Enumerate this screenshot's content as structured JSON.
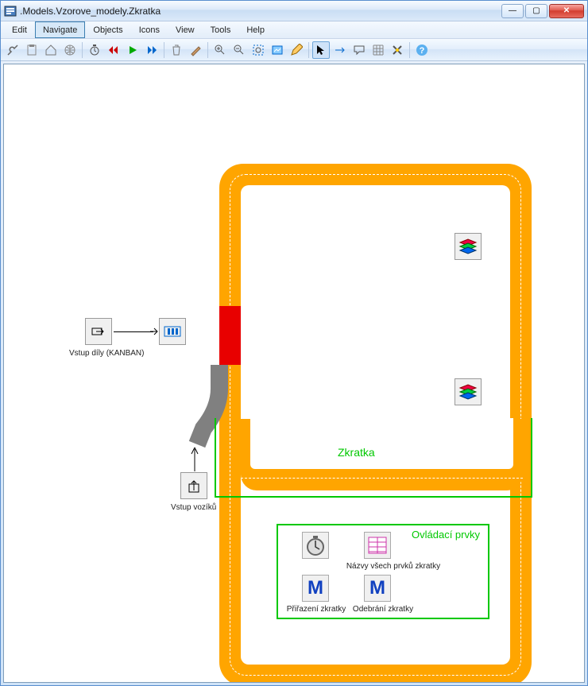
{
  "window": {
    "title": ".Models.Vzorove_modely.Zkratka"
  },
  "menu": {
    "edit": "Edit",
    "navigate": "Navigate",
    "objects": "Objects",
    "icons": "Icons",
    "view": "View",
    "tools": "Tools",
    "help": "Help"
  },
  "labels": {
    "vstup_dily": "Vstup díly (KANBAN)",
    "vstup_voziku": "Vstup vozíků",
    "zkratka": "Zkratka",
    "ovladaci_title": "Ovládací prvky",
    "nazvy": "Názvy všech prvků zkratky",
    "prirazeni": "Přiřazení zkratky",
    "odebrani": "Odebrání zkratky"
  },
  "winbtn": {
    "min": "—",
    "max": "▢",
    "close": "✕"
  }
}
